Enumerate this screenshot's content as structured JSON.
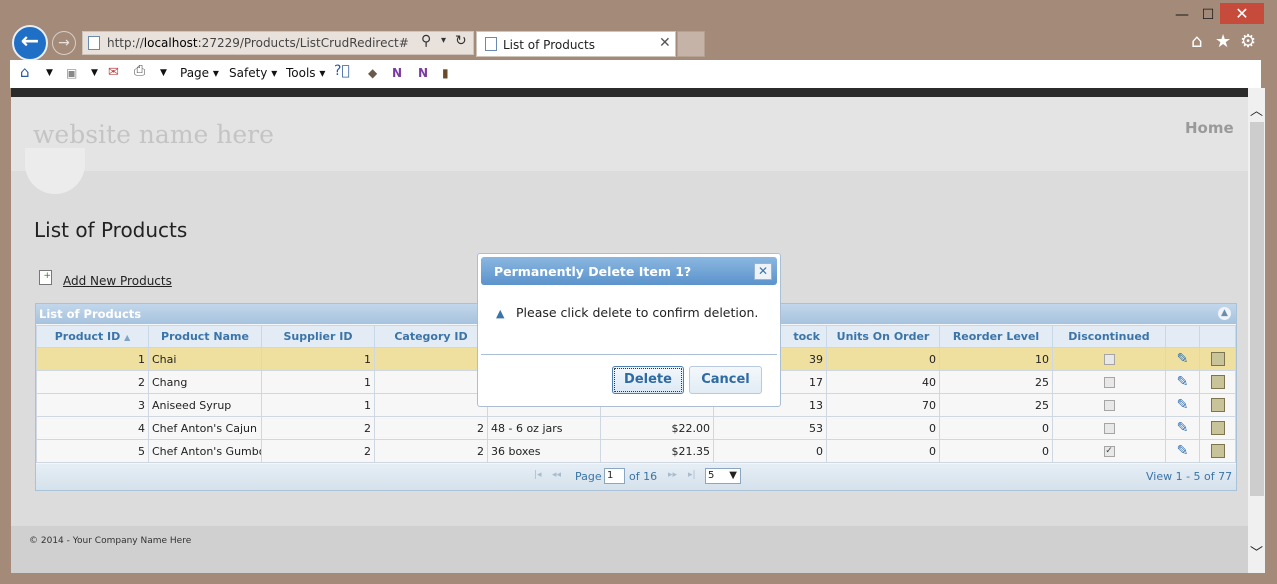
{
  "browser": {
    "url_prefix": "http://",
    "url_host": "localhost",
    "url_rest": ":27229/Products/ListCrudRedirect#",
    "tab_title": "List of Products",
    "window_controls": {
      "minimize": "—",
      "maximize": "☐",
      "close": "✕"
    },
    "top_icons": {
      "home": "⌂",
      "favorites": "★",
      "settings": "⚙"
    },
    "commands": {
      "page": "Page",
      "safety": "Safety",
      "tools": "Tools"
    }
  },
  "site": {
    "title": "website name here",
    "nav_home": "Home",
    "footer": "© 2014 - Your Company Name Here"
  },
  "main": {
    "page_title": "List of Products",
    "add_link": "Add New Products"
  },
  "grid": {
    "caption": "List of Products",
    "columns": [
      "Product ID",
      "Product Name",
      "Supplier ID",
      "Category ID",
      "",
      "",
      "tock",
      "Units On Order",
      "Reorder Level",
      "Discontinued",
      "",
      ""
    ],
    "sort_indicator": "▲",
    "rows": [
      {
        "id": "1",
        "name": "Chai",
        "supplier": "1",
        "category": "",
        "qty": "",
        "price": "",
        "stock": "39",
        "on_order": "0",
        "reorder": "10",
        "discontinued": false,
        "selected": true
      },
      {
        "id": "2",
        "name": "Chang",
        "supplier": "1",
        "category": "",
        "qty": "",
        "price": "",
        "stock": "17",
        "on_order": "40",
        "reorder": "25",
        "discontinued": false,
        "selected": false
      },
      {
        "id": "3",
        "name": "Aniseed Syrup",
        "supplier": "1",
        "category": "",
        "qty": "",
        "price": "",
        "stock": "13",
        "on_order": "70",
        "reorder": "25",
        "discontinued": false,
        "selected": false
      },
      {
        "id": "4",
        "name": "Chef Anton's Cajun S",
        "supplier": "2",
        "category": "2",
        "qty": "48 - 6 oz jars",
        "price": "$22.00",
        "stock": "53",
        "on_order": "0",
        "reorder": "0",
        "discontinued": false,
        "selected": false
      },
      {
        "id": "5",
        "name": "Chef Anton's Gumbo",
        "supplier": "2",
        "category": "2",
        "qty": "36 boxes",
        "price": "$21.35",
        "stock": "0",
        "on_order": "0",
        "reorder": "0",
        "discontinued": true,
        "selected": false
      }
    ],
    "pager": {
      "page_label": "Page",
      "current_page": "1",
      "of_label": "of 16",
      "rows_per_page": "5",
      "view_text": "View 1 - 5 of 77"
    }
  },
  "dialog": {
    "title": "Permanently Delete Item 1?",
    "message": "Please click delete to confirm deletion.",
    "delete_label": "Delete",
    "cancel_label": "Cancel"
  }
}
